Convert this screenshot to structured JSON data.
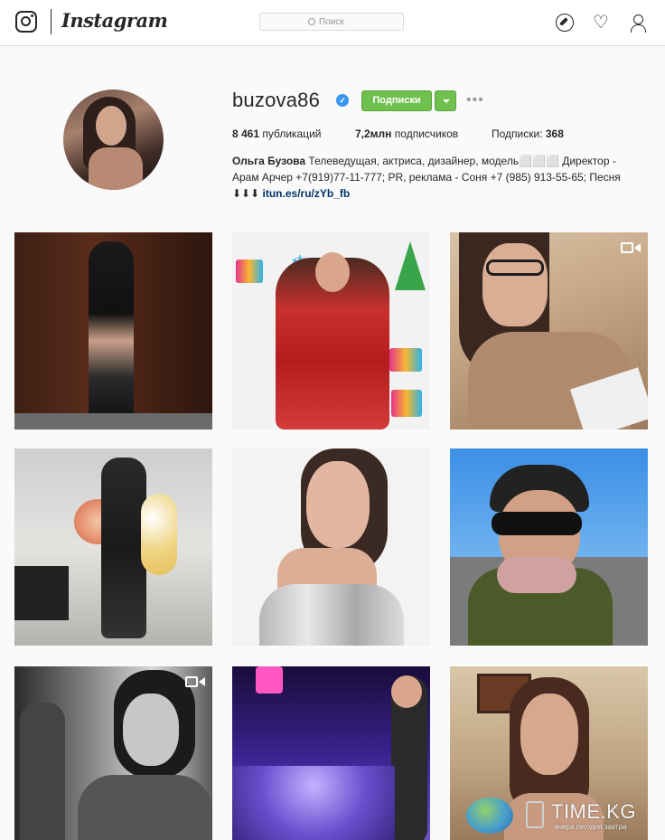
{
  "header": {
    "logo_icon": "instagram-camera-icon",
    "wordmark": "Instagram",
    "search_placeholder": "Поиск",
    "icons": [
      "compass-icon",
      "heart-icon",
      "user-icon"
    ]
  },
  "profile": {
    "username": "buzova86",
    "verified_icon": "verified-badge-icon",
    "follow_label": "Подписки",
    "follow_color": "#70c050",
    "stats": {
      "posts_value": "8 461",
      "posts_label": "публикаций",
      "followers_value": "7,2млн",
      "followers_label": "подписчиков",
      "following_label": "Подписки:",
      "following_value": "368"
    },
    "bio_name": "Ольга Бузова",
    "bio_text": "Телеведущая, актриса, дизайнер, модель⬜⬜⬜ Директор - Арам Арчер +7(919)77-11-777; PR, реклама - Соня +7 (985) 913-55-65; Песня ⬇⬇⬇",
    "bio_link": "itun.es/ru/zYb_fb"
  },
  "posts": [
    {
      "alt": "post-1",
      "video": false
    },
    {
      "alt": "post-2",
      "video": false
    },
    {
      "alt": "post-3",
      "video": true
    },
    {
      "alt": "post-4",
      "video": false
    },
    {
      "alt": "post-5",
      "video": false
    },
    {
      "alt": "post-6",
      "video": false
    },
    {
      "alt": "post-7",
      "video": true
    },
    {
      "alt": "post-8",
      "video": false
    },
    {
      "alt": "post-9",
      "video": false
    }
  ],
  "watermark": {
    "brand": "TIME.KG",
    "tagline": "вчера сегодня завтра"
  }
}
